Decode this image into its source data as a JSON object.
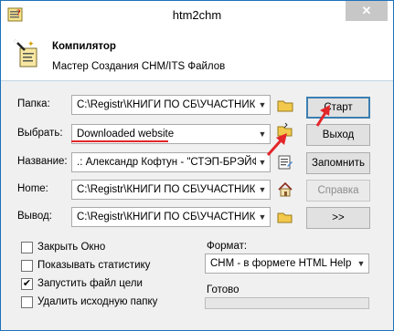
{
  "window": {
    "title": "htm2chm",
    "close_glyph": "✕"
  },
  "header": {
    "title": "Компилятор",
    "subtitle": "Мастер Создания CHM/ITS Файлов"
  },
  "fields": {
    "folder": {
      "label": "Папка:",
      "value": "C:\\Registr\\КНИГИ ПО СБ\\УЧАСТНИК"
    },
    "select": {
      "label": "Выбрать:",
      "value": "Downloaded website"
    },
    "name": {
      "label": "Название:",
      "value": ".: Александр Кофтун - \"СТЭП-БРЭЙФ"
    },
    "home": {
      "label": "Home:",
      "value": "C:\\Registr\\КНИГИ ПО СБ\\УЧАСТНИК"
    },
    "output": {
      "label": "Вывод:",
      "value": "C:\\Registr\\КНИГИ ПО СБ\\УЧАСТНИК"
    }
  },
  "buttons": {
    "start": "Старт",
    "exit": "Выход",
    "remember": "Запомнить",
    "help": "Справка",
    "more": ">>"
  },
  "options": [
    {
      "label": "Закрыть Окно",
      "checked": false
    },
    {
      "label": "Показывать статистику",
      "checked": false
    },
    {
      "label": "Запустить файл цели",
      "checked": true
    },
    {
      "label": "Удалить исходную папку",
      "checked": false
    }
  ],
  "format": {
    "label": "Формат:",
    "value": "CHM - в формете HTML Help"
  },
  "status": {
    "label": "Готово",
    "progress": 0
  },
  "icons": {
    "folder": "folder-icon",
    "select": "open-folder-icon",
    "name": "edit-document-icon",
    "home": "home-icon",
    "output": "open-folder-icon"
  },
  "colors": {
    "accent": "#1c72b8",
    "annotation": "#e3262a"
  }
}
